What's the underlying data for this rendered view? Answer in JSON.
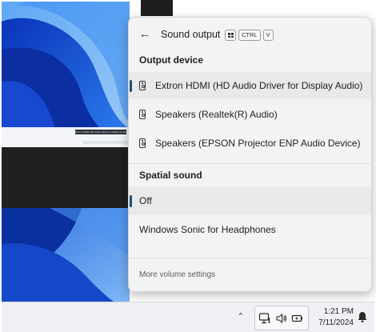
{
  "mini_window": {
    "title": "Extron HDMI (HD Audio Driver for Display Audio)"
  },
  "flyout": {
    "title": "Sound output",
    "shortcut_keys": [
      "CTRL",
      "V"
    ],
    "output_section_title": "Output device",
    "devices": [
      {
        "label": "Extron HDMI (HD Audio Driver for Display Audio)",
        "icon": "speaker-device-icon",
        "selected": true
      },
      {
        "label": "Speakers (Realtek(R) Audio)",
        "icon": "speaker-device-icon",
        "selected": false
      },
      {
        "label": "Speakers (EPSON Projector ENP Audio Device)",
        "icon": "speaker-device-icon",
        "selected": false
      }
    ],
    "spatial_section_title": "Spatial sound",
    "spatial_options": [
      {
        "label": "Off",
        "selected": true
      },
      {
        "label": "Windows Sonic for Headphones",
        "selected": false
      }
    ],
    "more_settings_label": "More volume settings"
  },
  "taskbar": {
    "chevron_icon": "chevron-up-icon",
    "tray_icons": [
      "network-icon",
      "volume-icon",
      "battery-icon"
    ],
    "time": "1:21 PM",
    "date": "7/11/2024",
    "notification_icon": "notification-bell-icon"
  },
  "colors": {
    "accent": "#1f4e79",
    "flyout_bg": "#f2f3f4",
    "wallpaper": "#1a5fd6",
    "taskbar_bg": "#eef0f3"
  }
}
